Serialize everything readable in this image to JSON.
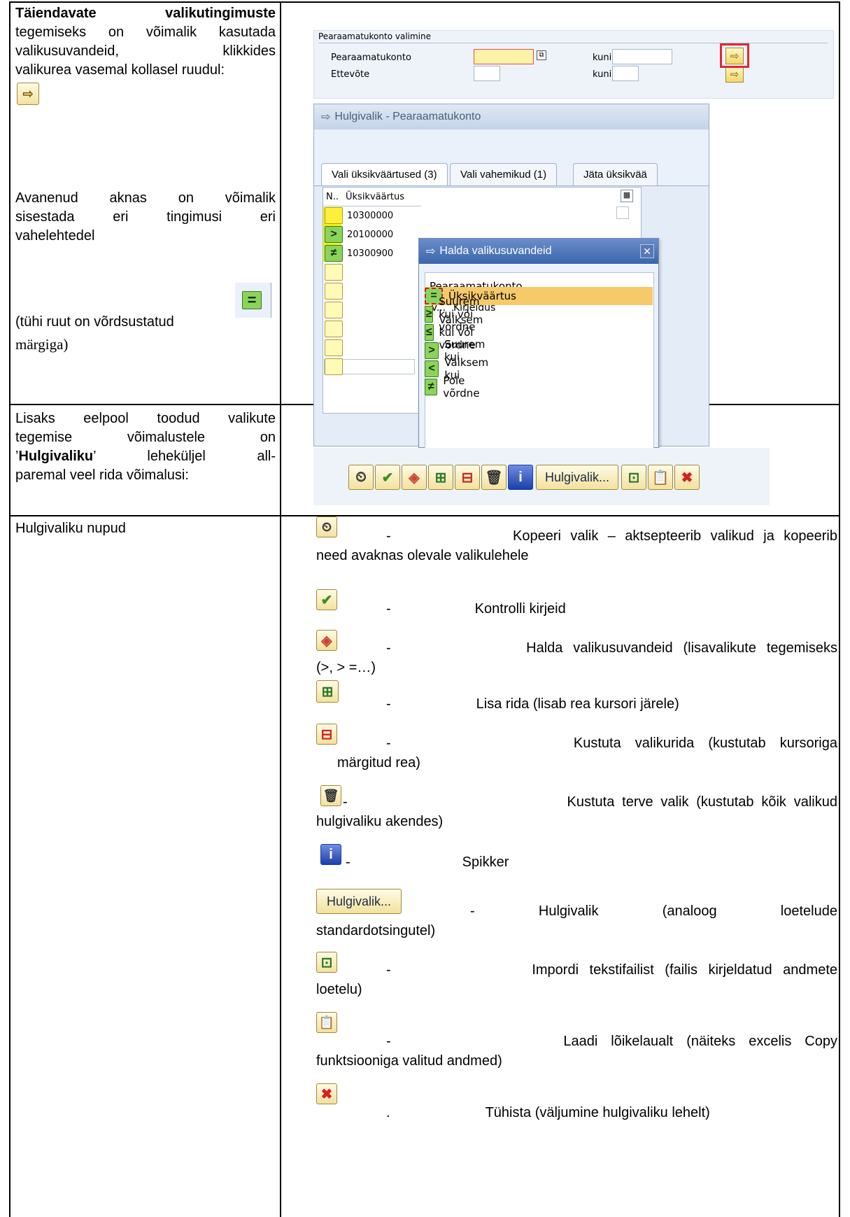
{
  "left_col": {
    "r1_bold": "Täiendavate valikutingimuste",
    "r1_text": [
      "tegemiseks on võimalik kasutada",
      "valikusuvandeid, klikkides",
      "valikurea vasemal kollasel ruudul:"
    ],
    "r1_text2": [
      "Avanenud aknas on võimalik",
      "sisestada eri tingimusi eri",
      "vahelehtedel"
    ],
    "r1_text3": "(tühi ruut on võrdsustatud",
    "r1_text3b": "märgiga)",
    "r2_text_a": "Lisaks eelpool toodud valikute",
    "r2_text_b": "tegemise võimalustele on",
    "r2_q1": "’",
    "r2_bold": "Hulgivaliku",
    "r2_q2": "’",
    "r2_text_c": "leheküljel all-",
    "r2_text_d": "paremal veel rida võimalusi:",
    "r3_text": "Hulgivaliku nupud"
  },
  "sap_select": {
    "header": "Pearaamatukonto valimine",
    "row1_label": "Pearaamatukonto",
    "row2_label": "Ettevõte",
    "kuni": "kuni"
  },
  "sap_dialog": {
    "title": "Hulgivalik - Pearaamatukonto",
    "tabs": [
      "Vali üksikväärtused (3)",
      "Vali vahemikud (1)",
      "Jäta üksikvää"
    ],
    "col_n": "N..",
    "col_value": "Üksikväärtus",
    "values": [
      "10300000",
      "20100000",
      "10300900"
    ],
    "row_signs": [
      "",
      ">",
      "≠"
    ]
  },
  "sap_sub": {
    "title": "Halda valikusuvandeid",
    "group": "Pearaamatukonto",
    "col_v": "V...",
    "col_desc": "Kirjeldus",
    "options": [
      {
        "sign": "=",
        "label": "Üksikväärtus"
      },
      {
        "sign": "≥",
        "label": "Suurem kui või võrdne"
      },
      {
        "sign": "≤",
        "label": "Väiksem kui või võrdne"
      },
      {
        "sign": ">",
        "label": "Suurem kui"
      },
      {
        "sign": "<",
        "label": "Väiksem kui"
      },
      {
        "sign": "≠",
        "label": "Pole võrdne"
      }
    ]
  },
  "toolbar": {
    "hulgivalik_label": "Hulgivalik..."
  },
  "buttons_list": [
    {
      "dash": "-",
      "a": "Kopeeri valik – aktsepteerib valikud ja kopeerib",
      "b": "need avaknas olevale valikulehele"
    },
    {
      "dash": "-",
      "a": "Kontrolli kirjeid"
    },
    {
      "dash": "-",
      "a": "Halda valikusuvandeid (lisavalikute tegemiseks",
      "b": "(>, > =…)"
    },
    {
      "dash": "-",
      "a": "Lisa rida (lisab rea kursori järele)"
    },
    {
      "dash": "-",
      "a": "Kustuta valikurida (kustutab kursoriga",
      "b": "märgitud rea)"
    },
    {
      "dash": "-",
      "a": "Kustuta terve valik (kustutab kõik valikud",
      "b": "hulgivaliku akendes)"
    },
    {
      "dash": "-",
      "a": "Spikker"
    },
    {
      "dash": "-",
      "a": "Hulgivalik (analoog loetelude",
      "b": "standardotsingutel)"
    },
    {
      "dash": "-",
      "a": "Impordi tekstifailist (failis kirjeldatud andmete",
      "b": "loetelu)"
    },
    {
      "dash": "-",
      "a": "Laadi lõikelaualt (näiteks excelis Copy",
      "b": "funktsiooniga valitud andmed)"
    },
    {
      "dash": ".",
      "a": "Tühista (väljumine hulgivaliku lehelt)"
    }
  ],
  "icons": [
    "clock-execute-icon",
    "checkmark-icon",
    "options-diamond-icon",
    "insert-row-icon",
    "delete-row-icon",
    "trash-icon",
    "info-icon",
    "hulgivalik-button",
    "import-text-icon",
    "paste-clipboard-icon",
    "cancel-x-icon"
  ]
}
